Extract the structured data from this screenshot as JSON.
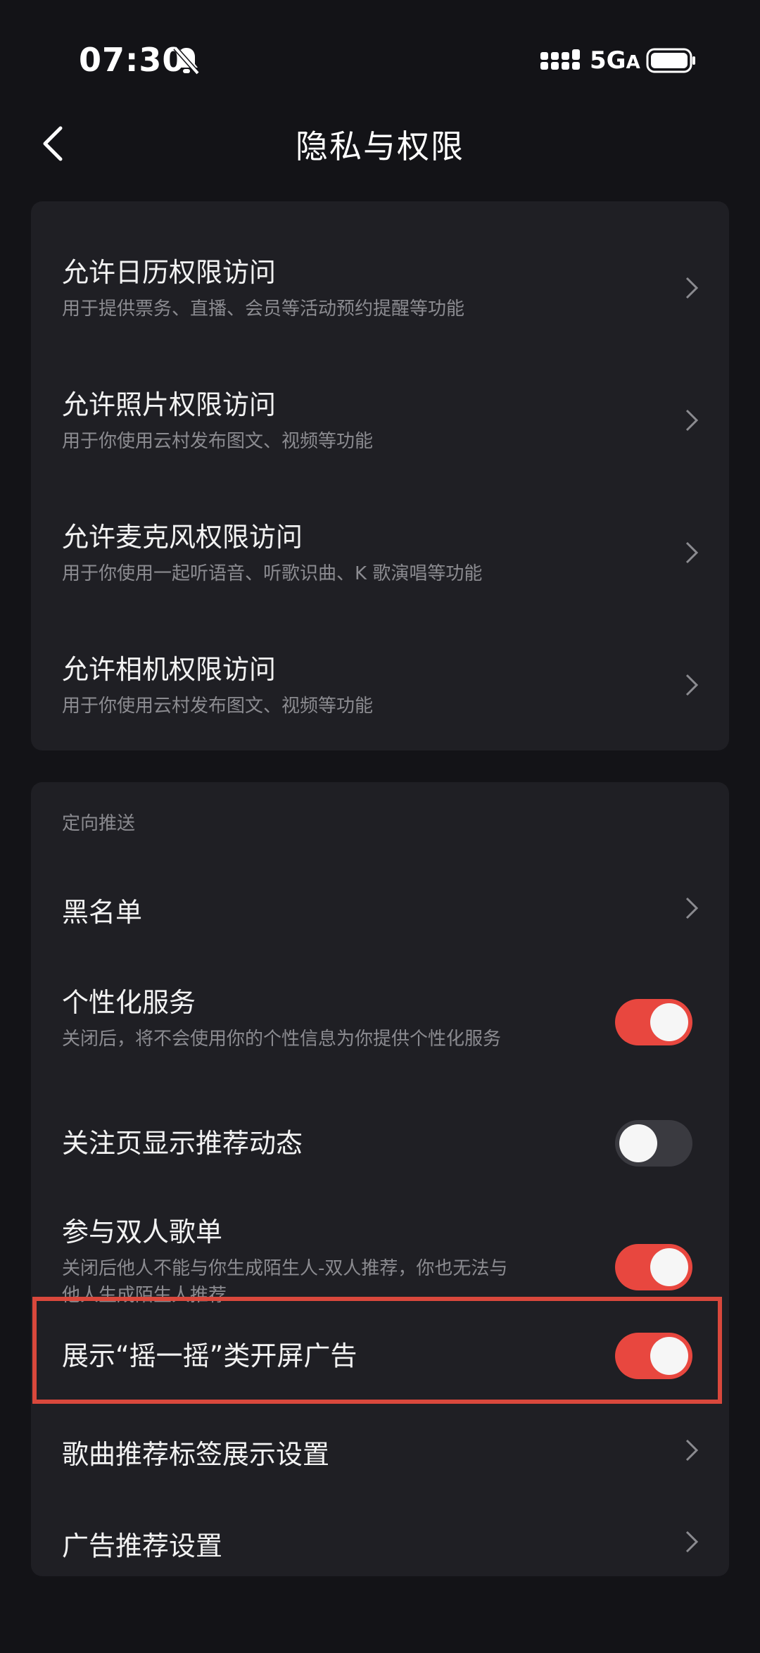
{
  "status_bar": {
    "time": "07:30",
    "network": "5G",
    "network_suffix": "A"
  },
  "nav": {
    "title": "隐私与权限"
  },
  "permissions": [
    {
      "title": "允许日历权限访问",
      "subtitle": "用于提供票务、直播、会员等活动预约提醒等功能"
    },
    {
      "title": "允许照片权限访问",
      "subtitle": "用于你使用云村发布图文、视频等功能"
    },
    {
      "title": "允许麦克风权限访问",
      "subtitle": "用于你使用一起听语音、听歌识曲、K 歌演唱等功能"
    },
    {
      "title": "允许相机权限访问",
      "subtitle": "用于你使用云村发布图文、视频等功能"
    }
  ],
  "push": {
    "section_label": "定向推送",
    "blacklist": {
      "title": "黑名单"
    },
    "personalized": {
      "title": "个性化服务",
      "subtitle": "关闭后，将不会使用你的个性信息为你提供个性化服务",
      "enabled": true
    },
    "follow_recommend": {
      "title": "关注页显示推荐动态",
      "enabled": false
    },
    "duo_playlist": {
      "title": "参与双人歌单",
      "subtitle_line1": "关闭后他人不能与你生成陌生人-双人推荐，你也无法与",
      "subtitle_line2": "他人生成陌生人推荐",
      "enabled": true
    },
    "shake_ad": {
      "title": "展示“摇一摇”类开屏广告",
      "enabled": true
    },
    "song_tags": {
      "title": "歌曲推荐标签展示设置"
    },
    "ad_settings": {
      "title": "广告推荐设置"
    }
  },
  "colors": {
    "background": "#131317",
    "card": "#1f1f24",
    "toggle_on": "#e8473f",
    "toggle_off": "#3a3a40",
    "highlight": "#d9483c"
  },
  "icons": {
    "mute": "bell-slash-icon",
    "signal": "signal-dots-icon",
    "battery": "battery-icon",
    "back": "chevron-left-icon",
    "row": "chevron-right-icon"
  }
}
